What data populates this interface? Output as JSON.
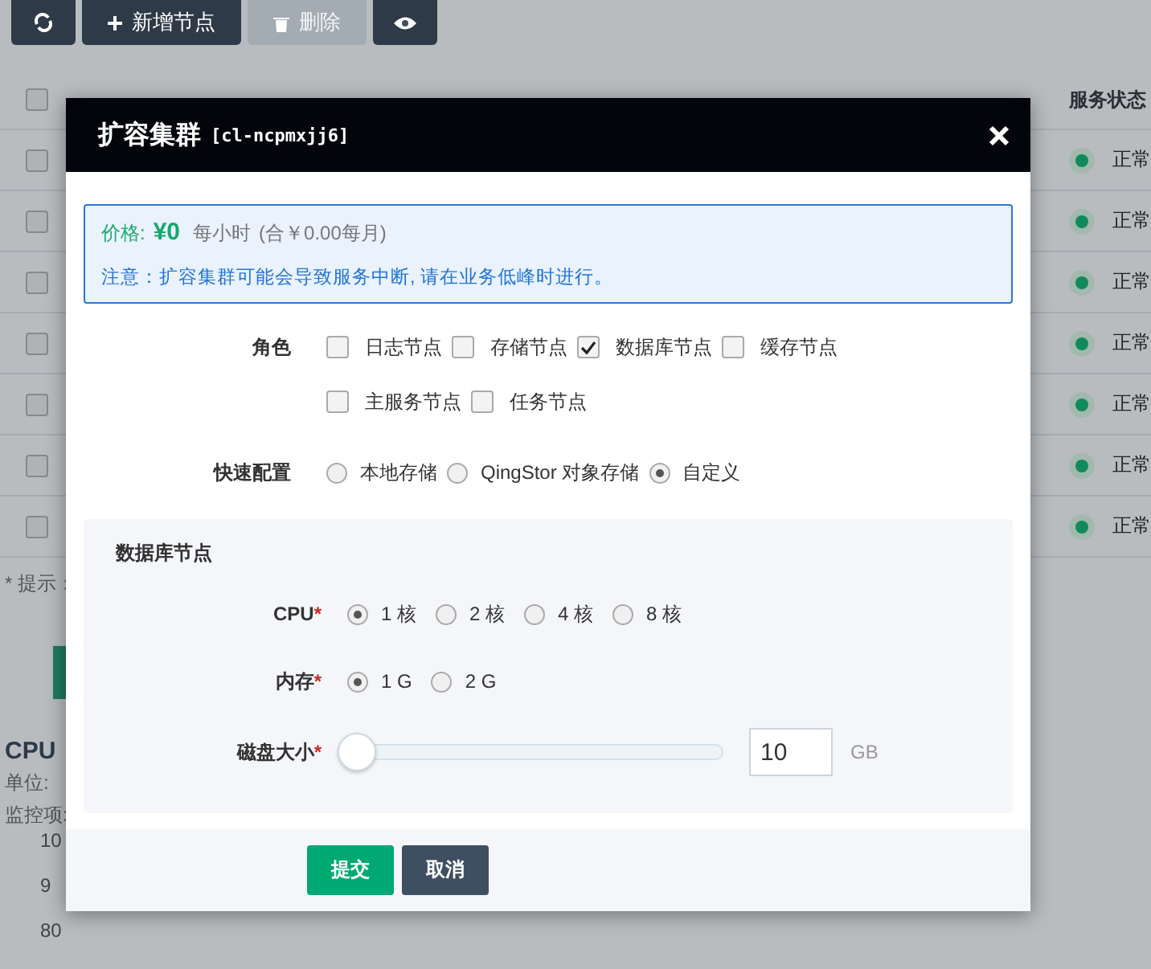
{
  "toolbar": {
    "buttons": [
      {
        "kind": "refresh",
        "disabled": false
      },
      {
        "kind": "add",
        "label": "新增节点",
        "disabled": false
      },
      {
        "kind": "delete",
        "label": "删除",
        "disabled": true
      },
      {
        "kind": "view",
        "disabled": false
      }
    ]
  },
  "table": {
    "header_checked": false,
    "status_header": "服务状态",
    "rows": [
      {
        "checked": false,
        "status": "正常",
        "color": "#0f8a5f"
      },
      {
        "checked": false,
        "status": "正常",
        "color": "#0f8a5f"
      },
      {
        "checked": false,
        "status": "正常",
        "color": "#0f8a5f"
      },
      {
        "checked": false,
        "status": "正常",
        "color": "#0f8a5f"
      },
      {
        "checked": false,
        "status": "正常",
        "color": "#0f8a5f"
      },
      {
        "checked": false,
        "status": "正常",
        "color": "#0f8a5f"
      },
      {
        "checked": false,
        "status": "正常",
        "color": "#0f8a5f"
      }
    ]
  },
  "hint": "* 提示：",
  "monitor": {
    "title": "CPU",
    "unit": "单位:",
    "item": "监控项:",
    "ticks": [
      "10",
      "9",
      "80"
    ]
  },
  "modal": {
    "title": "扩容集群",
    "cluster_id": "[cl-ncpmxjj6]",
    "price": {
      "label": "价格:",
      "amount": "¥0",
      "unit": "每小时",
      "monthly": "(合￥0.00每月)"
    },
    "notice": "注意：扩容集群可能会导致服务中断, 请在业务低峰时进行。",
    "roles": {
      "label": "角色",
      "options": [
        {
          "label": "日志节点",
          "checked": false
        },
        {
          "label": "存储节点",
          "checked": false
        },
        {
          "label": "数据库节点",
          "checked": true
        },
        {
          "label": "缓存节点",
          "checked": false
        },
        {
          "label": "主服务节点",
          "checked": false
        },
        {
          "label": "任务节点",
          "checked": false
        }
      ]
    },
    "quick_config": {
      "label": "快速配置",
      "options": [
        {
          "label": "本地存储",
          "selected": false
        },
        {
          "label": "QingStor 对象存储",
          "selected": false
        },
        {
          "label": "自定义",
          "selected": true
        }
      ]
    },
    "panel": {
      "title": "数据库节点",
      "cpu": {
        "label": "CPU",
        "required_mark": "*",
        "options": [
          {
            "label": "1 核",
            "selected": true
          },
          {
            "label": "2 核",
            "selected": false
          },
          {
            "label": "4 核",
            "selected": false
          },
          {
            "label": "8 核",
            "selected": false
          }
        ]
      },
      "memory": {
        "label": "内存",
        "required_mark": "*",
        "options": [
          {
            "label": "1 G",
            "selected": true
          },
          {
            "label": "2 G",
            "selected": false
          }
        ]
      },
      "disk": {
        "label": "磁盘大小",
        "required_mark": "*",
        "level": 0,
        "value": "10",
        "unit": "GB"
      }
    },
    "buttons": {
      "submit": "提交",
      "cancel": "取消"
    }
  }
}
